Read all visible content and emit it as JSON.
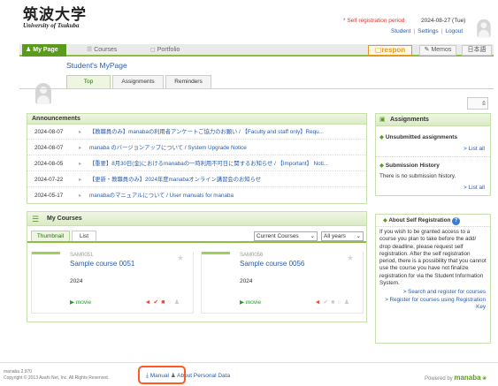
{
  "header": {
    "logo_jp": "筑波大学",
    "logo_en": "University of Tsukuba",
    "self_reg_notice": "* Self registration period",
    "date": "2024-08-27 (Tue)",
    "links": [
      "Student",
      "Settings",
      "Logout"
    ]
  },
  "nav": {
    "mypage": "My Page",
    "courses": "Courses",
    "portfolio": "Portfolio",
    "respon": "respon",
    "memos": "Memos",
    "language": "日本語"
  },
  "mypage": {
    "title": "Student's MyPage",
    "tabs": [
      "Top",
      "Assignments",
      "Reminders"
    ]
  },
  "announcements": {
    "title": "Announcements",
    "items": [
      {
        "date": "2024-08-07",
        "title": "【教職員のみ】manabaの利用者アンケートご協力のお願い / 【Faculty and staff only】Requ..."
      },
      {
        "date": "2024-08-07",
        "title": "manaba のバージョンアップについて / System Upgrade Notice"
      },
      {
        "date": "2024-08-05",
        "title": "【重要】8月30日(金)におけるmanabaの一時利用不可日に関するお知らせ / 【Important】 Noti..."
      },
      {
        "date": "2024-07-22",
        "title": "【更新・教職員のみ】2024年度manabaオンライン講習会のお知らせ"
      },
      {
        "date": "2024-05-17",
        "title": "manabaのマニュアルについて / User manuals for manaba"
      }
    ]
  },
  "my_courses": {
    "title": "My Courses",
    "tabs": [
      "Thumbnail",
      "List"
    ],
    "filter_select": "Current Courses",
    "year_select": "All years",
    "items": [
      {
        "code": "SAM0051",
        "name": "Sample course 0051",
        "year": "2024",
        "movie": "movie"
      },
      {
        "code": "SAM0056",
        "name": "Sample course 0056",
        "year": "2024",
        "movie": "movie"
      }
    ]
  },
  "assignments": {
    "title": "Assignments",
    "unsubmitted": "Unsubmitted assignments",
    "list_all": "List all",
    "history": "Submission History",
    "no_history": "There is no submission history.",
    "list_all2": "List all"
  },
  "self_registration": {
    "title": "About Self Registration",
    "body": "If you wish to be granted access to a course you plan to take before the add/ drop deadline, please request self registration. After the self registration period, there is a possibility that you cannot use the course you have not finalize registration for via the Student Information System.",
    "link1": "Search and register for courses",
    "link2": "Register for courses using Registration Key"
  },
  "footer": {
    "version": "manaba 2.970",
    "copyright": "Copyright © 2013 Asahi Net, Inc. All Rights Reserved.",
    "manual": "Manual",
    "personal_data": "About Personal Data",
    "powered": "Powered by",
    "brand": "manaba"
  },
  "colors": {
    "accent_green": "#5c9a1e",
    "link_blue": "#2a5caa",
    "notice_red": "#e2342e",
    "highlight_orange": "#ff5a1f"
  }
}
